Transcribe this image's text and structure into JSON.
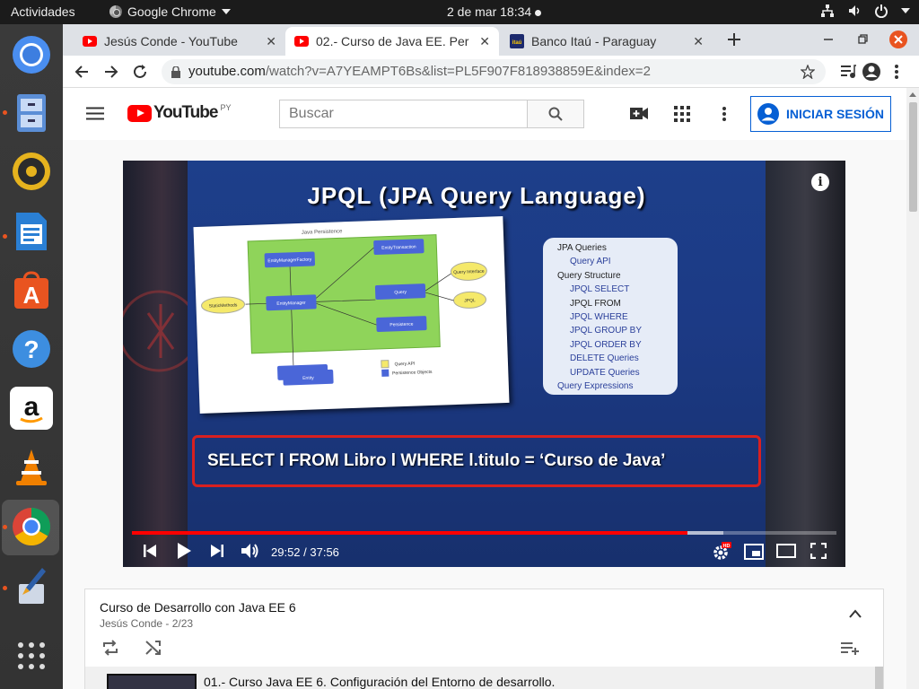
{
  "topbar": {
    "activities": "Actividades",
    "app_name": "Google Chrome",
    "clock": "2 de mar  18:34"
  },
  "tabs": [
    {
      "title": "Jesús Conde - YouTube",
      "favicon": "youtube"
    },
    {
      "title": "02.- Curso de Java EE. Per",
      "favicon": "youtube"
    },
    {
      "title": "Banco Itaú - Paraguay",
      "favicon": "itau"
    }
  ],
  "address": {
    "domain": "youtube.com",
    "path": "/watch?v=A7YEAMPT6Bs&list=PL5F907F818938859E&index=2"
  },
  "youtube": {
    "logo_text": "YouTube",
    "country": "PY",
    "search_placeholder": "Buscar",
    "signin_label": "INICIAR SESIÓN"
  },
  "video": {
    "slide_title": "JPQL (JPA Query Language)",
    "diagram_caption": "Java Persistence",
    "diagram_nodes": [
      "EntityManagerFactory",
      "EntityManager",
      "EntityTransaction",
      "Query",
      "Persistence",
      "Entity",
      "StaticMethods",
      "Query Interface",
      "JPQL",
      "Query API",
      "Persistence Objects"
    ],
    "menu_items": [
      {
        "label": "JPA Queries",
        "dark": true
      },
      {
        "label": "Query API",
        "dark": false
      },
      {
        "label": "Query Structure",
        "dark": true
      },
      {
        "label": "JPQL SELECT",
        "dark": false
      },
      {
        "label": "JPQL FROM",
        "dark": true
      },
      {
        "label": "JPQL WHERE",
        "dark": false
      },
      {
        "label": "JPQL GROUP BY",
        "dark": false
      },
      {
        "label": "JPQL ORDER BY",
        "dark": false
      },
      {
        "label": "DELETE Queries",
        "dark": false
      },
      {
        "label": "UPDATE Queries",
        "dark": false
      },
      {
        "label": "Query Expressions",
        "dark": false
      }
    ],
    "sql": "SELECT l FROM Libro l WHERE l.titulo = ‘Curso de Java’",
    "time": "29:52 / 37:56",
    "progress_fraction": 0.788,
    "buffered_fraction": 0.84,
    "info": "i",
    "hd_badge": "HD"
  },
  "playlist": {
    "title": "Curso de Desarrollo con Java EE 6",
    "subtitle": "Jesús Conde - 2/23",
    "first_item": "01.- Curso Java EE 6. Configuración del Entorno de desarrollo."
  },
  "colors": {
    "youtube_red": "#ff0000",
    "link_blue": "#065fd4",
    "ubuntu_orange": "#e95420"
  }
}
